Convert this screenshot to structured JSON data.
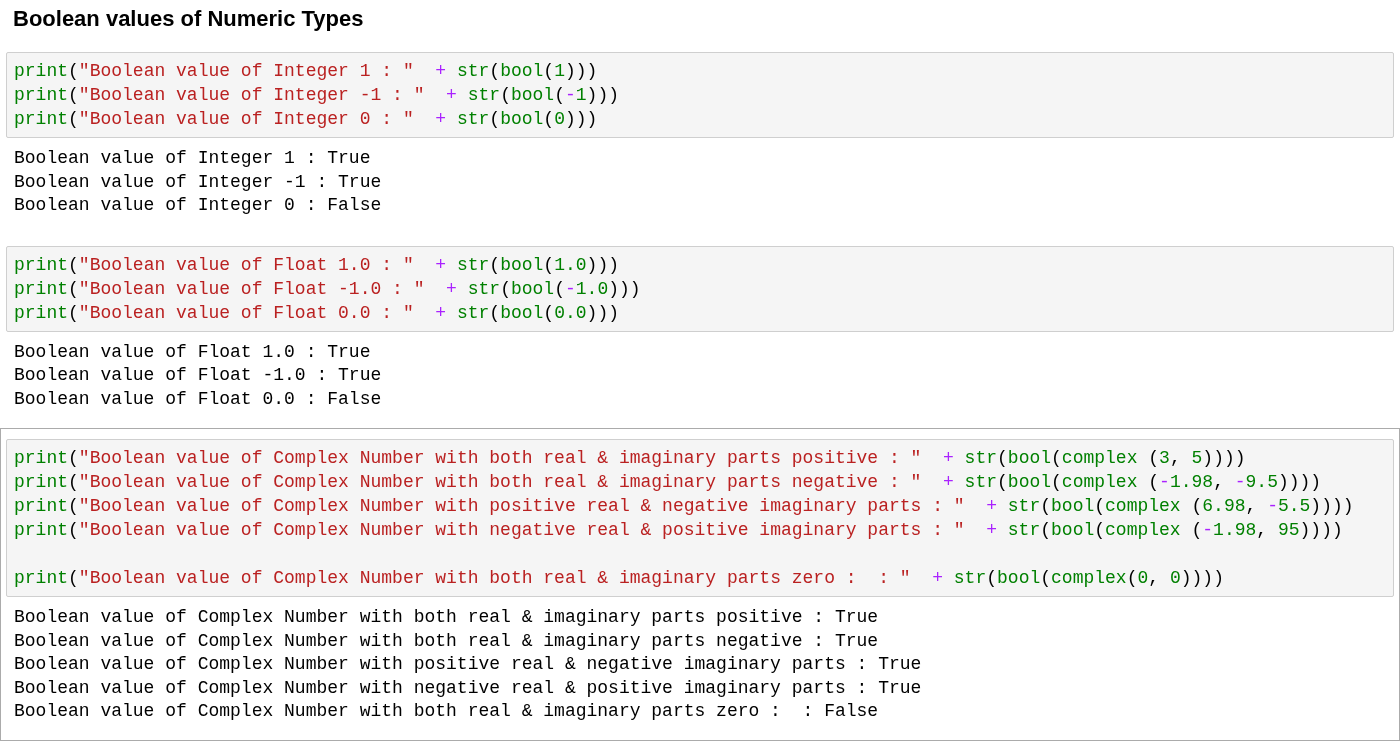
{
  "title": "Boolean values of Numeric Types",
  "cells": [
    {
      "selected": false,
      "code": [
        [
          "print(\"Boolean value of Integer 1 : \"  + str(bool(1)))",
          "print(\"Boolean value of Integer -1 : \"  + str(bool(-1)))",
          "print(\"Boolean value of Integer 0 : \"  + str(bool(0)))"
        ]
      ],
      "output": [
        "Boolean value of Integer 1 : True",
        "Boolean value of Integer -1 : True",
        "Boolean value of Integer 0 : False"
      ]
    },
    {
      "selected": false,
      "code": [
        [
          "print(\"Boolean value of Float 1.0 : \"  + str(bool(1.0)))",
          "print(\"Boolean value of Float -1.0 : \"  + str(bool(-1.0)))",
          "print(\"Boolean value of Float 0.0 : \"  + str(bool(0.0)))"
        ]
      ],
      "output": [
        "Boolean value of Float 1.0 : True",
        "Boolean value of Float -1.0 : True",
        "Boolean value of Float 0.0 : False"
      ]
    },
    {
      "selected": true,
      "code": [
        [
          "print(\"Boolean value of Complex Number with both real & imaginary parts positive : \"  + str(bool(complex (3, 5))))",
          "print(\"Boolean value of Complex Number with both real & imaginary parts negative : \"  + str(bool(complex (-1.98, -9.5))))",
          "print(\"Boolean value of Complex Number with positive real & negative imaginary parts : \"  + str(bool(complex (6.98, -5.5))))",
          "print(\"Boolean value of Complex Number with negative real & positive imaginary parts : \"  + str(bool(complex (-1.98, 95))))"
        ],
        [
          "print(\"Boolean value of Complex Number with both real & imaginary parts zero :  : \"  + str(bool(complex(0, 0))))"
        ]
      ],
      "output": [
        "Boolean value of Complex Number with both real & imaginary parts positive : True",
        "Boolean value of Complex Number with both real & imaginary parts negative : True",
        "Boolean value of Complex Number with positive real & negative imaginary parts : True",
        "Boolean value of Complex Number with negative real & positive imaginary parts : True",
        "Boolean value of Complex Number with both real & imaginary parts zero :  : False"
      ]
    }
  ]
}
